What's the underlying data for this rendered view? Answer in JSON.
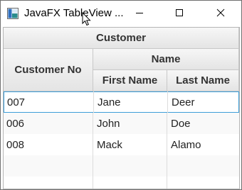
{
  "window": {
    "title": "JavaFX TableView ...",
    "icons": {
      "app": "java-app-icon",
      "minimize": "minimize-icon",
      "maximize": "maximize-icon",
      "close": "close-icon"
    }
  },
  "table": {
    "group_header": "Customer",
    "subgroup_header": "Name",
    "columns": {
      "customer_no": "Customer No",
      "first_name": "First Name",
      "last_name": "Last Name"
    },
    "rows": [
      {
        "customer_no": "007",
        "first_name": "Jane",
        "last_name": "Deer"
      },
      {
        "customer_no": "006",
        "first_name": "John",
        "last_name": "Doe"
      },
      {
        "customer_no": "008",
        "first_name": "Mack",
        "last_name": "Alamo"
      }
    ],
    "colors": {
      "selection_border": "#3c9ed8",
      "odd_row": "#f9f9f9",
      "header_border": "#c8c8c8"
    }
  }
}
